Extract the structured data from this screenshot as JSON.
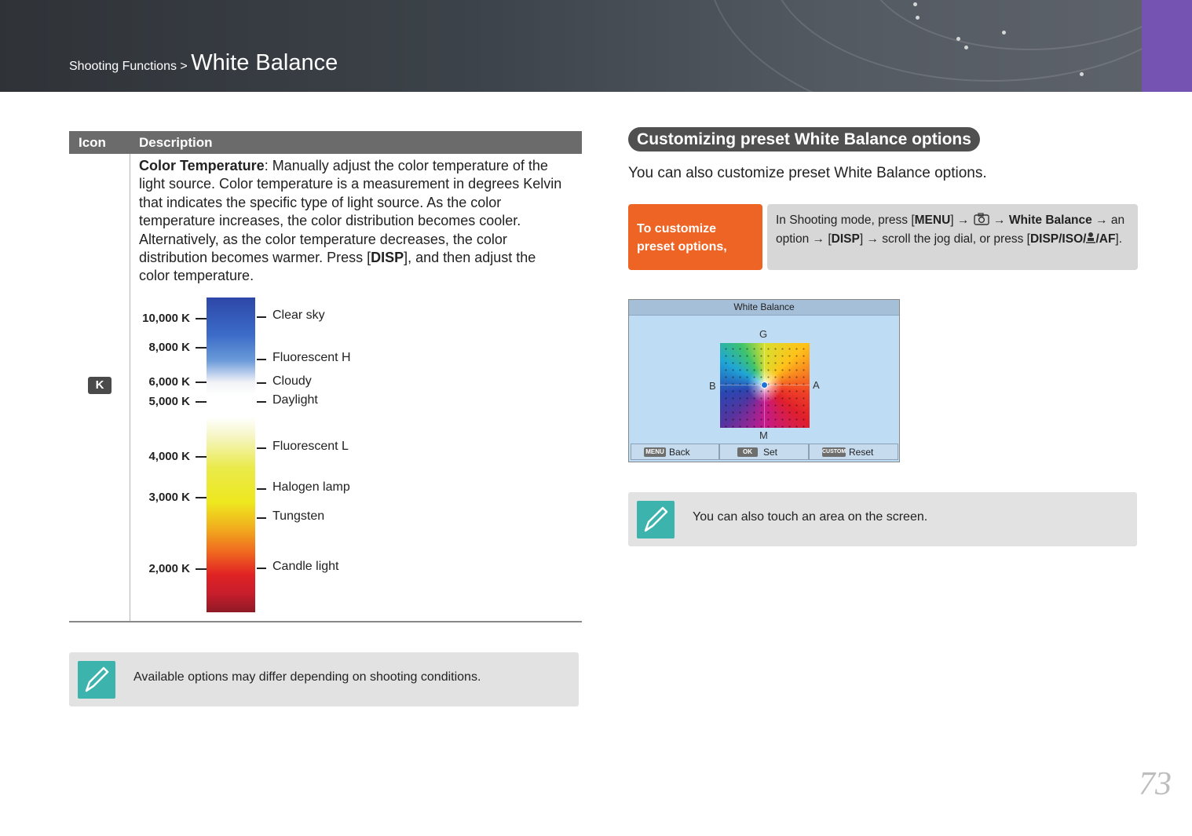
{
  "header": {
    "breadcrumb_section": "Shooting Functions >",
    "breadcrumb_title": "White Balance",
    "accent_color": "#7553b3"
  },
  "table": {
    "col_icon": "Icon",
    "col_description": "Description",
    "row_icon_label": "K",
    "desc_lead": "Color Temperature",
    "desc_part1": ": Manually adjust the color temperature of the light source. Color temperature is a measurement in degrees Kelvin that indicates the specific type of light source. As the color temperature increases, the color distribution becomes cooler. Alternatively, as the color temperature decreases, the color distribution becomes warmer. Press [",
    "desc_key": "DISP",
    "desc_part2": "], and then adjust the color temperature."
  },
  "color_scale": {
    "kelvin_labels": [
      "10,000 K",
      "8,000 K",
      "6,000 K",
      "5,000 K",
      "4,000 K",
      "3,000 K",
      "2,000 K"
    ],
    "source_labels": [
      "Clear sky",
      "Fluorescent H",
      "Cloudy",
      "Daylight",
      "Fluorescent L",
      "Halogen lamp",
      "Tungsten",
      "Candle light"
    ]
  },
  "note_left": {
    "icon": "pencil-note-icon",
    "text": "Available options may differ depending on shooting conditions."
  },
  "section": {
    "title": "Customizing preset White Balance options",
    "intro": "You can also customize preset White Balance options."
  },
  "step": {
    "label": "To customize preset options,",
    "text_a": "In Shooting mode, press [",
    "key_menu": "MENU",
    "text_b": "] → ",
    "camera_icon": "camera-icon",
    "text_c": " → ",
    "kw_white_balance": "White Balance",
    "text_d": " → an option → [",
    "key_disp": "DISP",
    "text_e": "] → scroll the jog dial, or press [",
    "key_combo": "DISP/ISO/",
    "key_af": "/AF",
    "text_f": "]."
  },
  "camera_screen": {
    "title": "White Balance",
    "axis_g": "G",
    "axis_m": "M",
    "axis_b": "B",
    "axis_a": "A",
    "btn_back_badge": "MENU",
    "btn_back": "Back",
    "btn_set_badge": "OK",
    "btn_set": "Set",
    "btn_reset_badge": "CUSTOM",
    "btn_reset": "Reset"
  },
  "note_right": {
    "icon": "pencil-note-icon",
    "text": "You can also touch an area on the screen."
  },
  "page_number": "73"
}
